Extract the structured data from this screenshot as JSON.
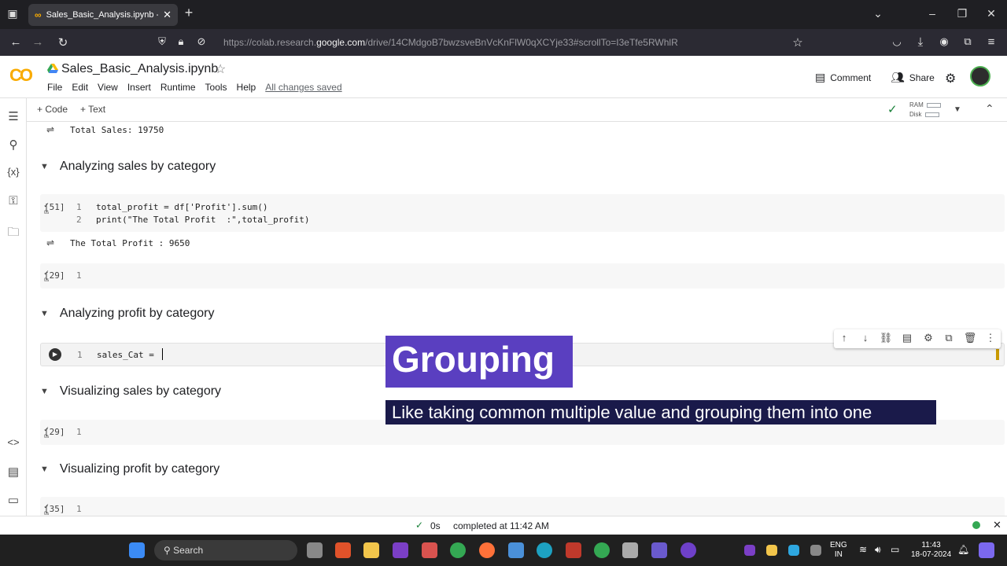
{
  "browser": {
    "tab_title": "Sales_Basic_Analysis.ipynb - Col",
    "tab_favicon": "colab-favicon",
    "url_prefix": "https://colab.research.",
    "url_domain": "google.com",
    "url_rest": "/drive/14CMdgoB7bwzsveBnVcKnFlW0qXCYje33#scrollTo=I3eTfe5RWhlR"
  },
  "colab": {
    "logo": "CO",
    "notebook_title": "Sales_Basic_Analysis.ipynb",
    "menu": [
      "File",
      "Edit",
      "View",
      "Insert",
      "Runtime",
      "Tools",
      "Help"
    ],
    "saved_status": "All changes saved",
    "comment_label": "Comment",
    "share_label": "Share"
  },
  "toolbar": {
    "add_code": "+ Code",
    "add_text": "+ Text",
    "ram_label": "RAM",
    "disk_label": "Disk"
  },
  "notebook": {
    "out_total_sales": "Total Sales: 19750",
    "sec_sales_category": "Analyzing sales by category",
    "cell51_count": "[51]",
    "cell51_line1_num": "1",
    "cell51_line2_num": "2",
    "cell51_time": "0s",
    "cell51_line1": "total_profit = df['Profit'].sum()",
    "cell51_line2": "print(\"The Total Profit  :\",total_profit)",
    "out_total_profit": "The Total Profit  : 9650",
    "cell29a_count": "[29]",
    "cell29a_num": "1",
    "cell29a_time": "0s",
    "sec_profit_category": "Analyzing profit by category",
    "active_line_num": "1",
    "active_code": "sales_Cat = ",
    "sec_vis_sales": "Visualizing sales by category",
    "cell29b_count": "[29]",
    "cell29b_num": "1",
    "cell29b_time": "0s",
    "sec_vis_profit": "Visualizing profit by category",
    "cell35_count": "[35]",
    "cell35_num": "1",
    "cell35_time": "0s"
  },
  "overlay": {
    "caption_title": "Grouping",
    "caption_sub": "Like taking common multiple value and grouping them into one"
  },
  "statusbar": {
    "time": "0s",
    "completed": "completed at 11:42 AM"
  },
  "taskbar": {
    "search": "Search",
    "lang1": "ENG",
    "lang2": "IN",
    "clock_time": "11:43",
    "clock_date": "18-07-2024"
  }
}
